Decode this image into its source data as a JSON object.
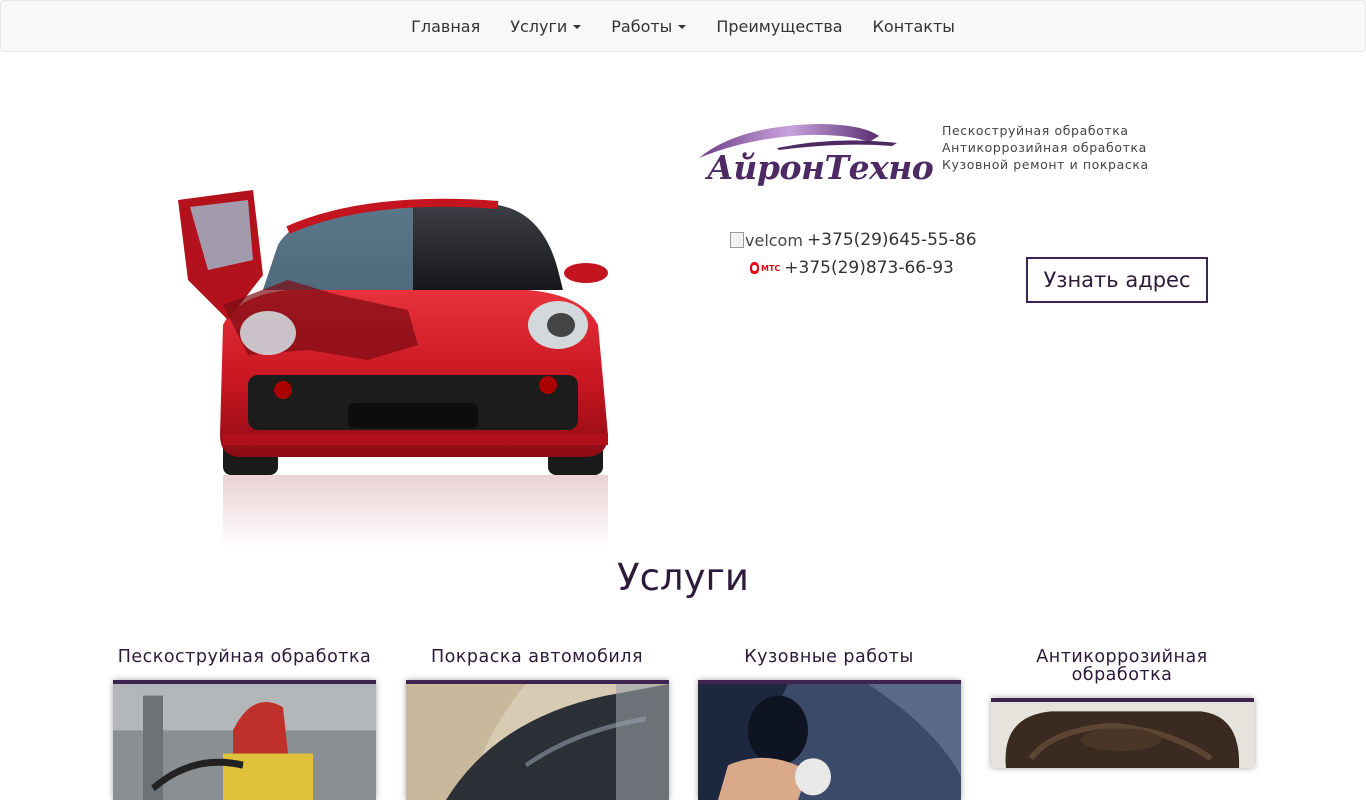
{
  "nav": {
    "items": [
      {
        "label": "Главная",
        "dropdown": false
      },
      {
        "label": "Услуги",
        "dropdown": true
      },
      {
        "label": "Работы",
        "dropdown": true
      },
      {
        "label": "Преимущества",
        "dropdown": false
      },
      {
        "label": "Контакты",
        "dropdown": false
      }
    ]
  },
  "brand": {
    "logo_text": "АйронТехно",
    "tagline": [
      "Пескоструйная обработка",
      "Антикоррозийная обработка",
      "Кузовной ремонт и покраска"
    ]
  },
  "contacts": {
    "velcom_alt": "velcom",
    "velcom_phone": "+375(29)645-55-86",
    "mts_logo_text": "МТС",
    "mts_phone": "+375(29)873-66-93",
    "address_button": "Узнать адрес"
  },
  "services": {
    "title": "Услуги",
    "items": [
      {
        "label": "Пескоструйная обработка"
      },
      {
        "label": "Покраска автомобиля"
      },
      {
        "label": "Кузовные работы"
      },
      {
        "label": "Антикоррозийная обработка"
      }
    ]
  },
  "colors": {
    "brand_purple": "#3f2450",
    "car_red": "#d5202b"
  }
}
